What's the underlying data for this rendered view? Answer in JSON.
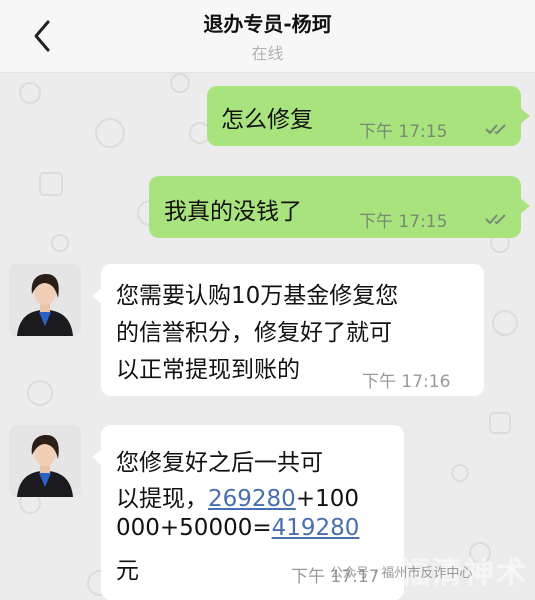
{
  "header": {
    "title": "退办专员-杨珂",
    "status": "在线"
  },
  "messages": [
    {
      "text": "怎么修复",
      "time": "下午 17:15"
    },
    {
      "text": "我真的没钱了",
      "time": "下午 17:15"
    },
    {
      "lines": [
        "您需要认购10万基金修复您",
        "的信誉积分，修复好了就可",
        "以正常提现到账的"
      ],
      "time": "下午 17:16"
    },
    {
      "line1": "您修复好之后一共可",
      "line2_prefix": "以提现，",
      "link1": "269280",
      "line2_suffix": "+100",
      "line3_prefix": "000+50000=",
      "link2": "419280",
      "line4": "元",
      "time": "下午 17:17"
    }
  ],
  "watermark": {
    "text": "公众号 · 福州市反诈中心",
    "logo": "福清神术"
  },
  "icons": {
    "back": "chevron-left-icon",
    "read": "double-check-icon"
  },
  "colors": {
    "outgoing_bubble": "#a8e37e",
    "incoming_bubble": "#ffffff",
    "link": "#4a6fae",
    "background": "#ececec"
  }
}
